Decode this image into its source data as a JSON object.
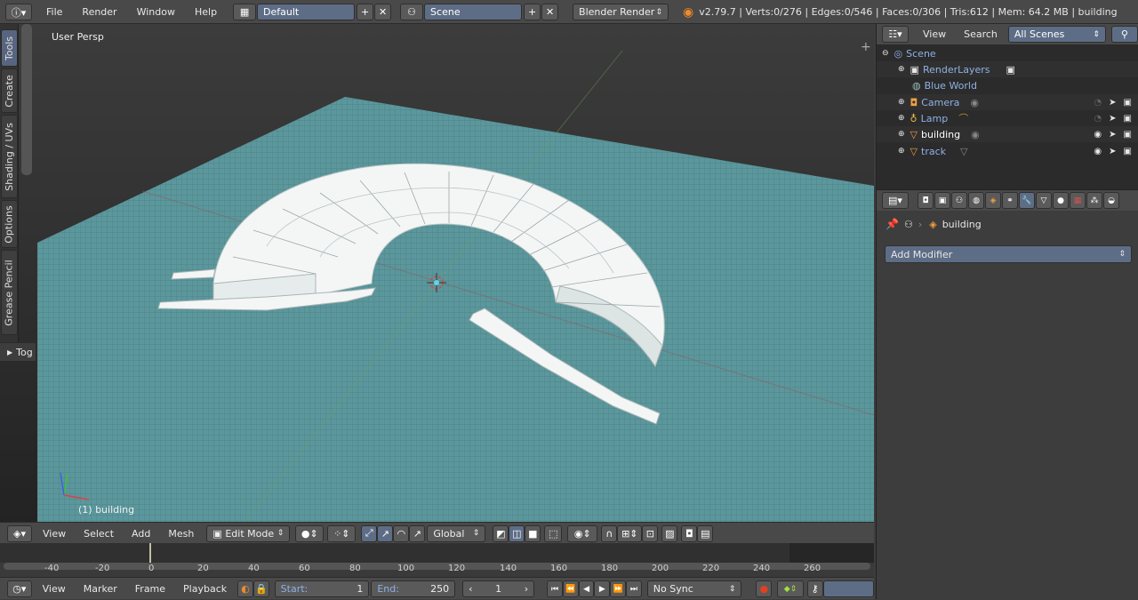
{
  "topbar": {
    "menus": [
      "File",
      "Render",
      "Window",
      "Help"
    ],
    "screen_layout": "Default",
    "scene": "Scene",
    "render_engine": "Blender Render",
    "stats": "v2.79.7 | Verts:0/276 | Edges:0/546 | Faces:0/306 | Tris:612 | Mem: 64.2 MB | building"
  },
  "toolshelf": {
    "tabs": [
      "Tools",
      "Create",
      "Shading / UVs",
      "Options",
      "Grease Pencil"
    ],
    "toggle_label": "Tog"
  },
  "viewport": {
    "view_label": "User Persp",
    "object_label": "(1) building"
  },
  "viewport_header": {
    "menus": [
      "View",
      "Select",
      "Add",
      "Mesh"
    ],
    "mode": "Edit Mode",
    "orientation": "Global"
  },
  "timeline": {
    "ticks": [
      "-40",
      "-20",
      "0",
      "20",
      "40",
      "60",
      "80",
      "100",
      "120",
      "140",
      "160",
      "180",
      "200",
      "220",
      "240",
      "260"
    ],
    "current_frame": "1"
  },
  "timeline_header": {
    "menus": [
      "View",
      "Marker",
      "Frame",
      "Playback"
    ],
    "start_label": "Start:",
    "start_value": "1",
    "end_label": "End:",
    "end_value": "250",
    "frame_value": "1",
    "sync": "No Sync"
  },
  "outliner": {
    "menus": [
      "View",
      "Search"
    ],
    "filter": "All Scenes",
    "items": [
      {
        "label": "Scene",
        "icon": "scene-icon"
      },
      {
        "label": "RenderLayers",
        "icon": "render-layers-icon"
      },
      {
        "label": "Blue World",
        "icon": "world-icon"
      },
      {
        "label": "Camera",
        "icon": "camera-icon"
      },
      {
        "label": "Lamp",
        "icon": "lamp-icon"
      },
      {
        "label": "building",
        "icon": "mesh-icon"
      },
      {
        "label": "track",
        "icon": "mesh-icon"
      }
    ]
  },
  "properties": {
    "context_object": "building",
    "add_modifier": "Add Modifier"
  },
  "colors": {
    "accent_blue": "#5e6d86",
    "ground": "#5d9a9f",
    "selected_text": "#8fb0e6"
  }
}
